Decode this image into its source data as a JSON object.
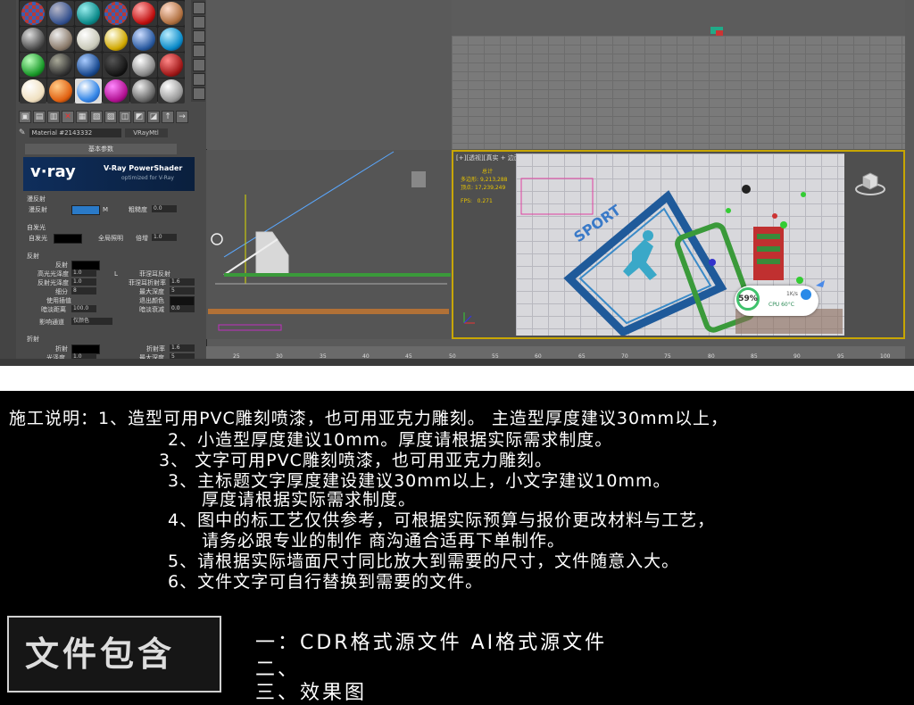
{
  "material_editor": {
    "material_name": "Material #2143332",
    "material_type": "VRayMtl",
    "rollout_title": "基本参数",
    "vray_logo": "v·ray",
    "vray_shader_title": "V-Ray PowerShader",
    "vray_shader_subtitle": "optimized for V-Ray",
    "sections": {
      "diffuse": "漫反射",
      "diffuse_label": "漫反射",
      "diffuse_map": "M",
      "roughness_label": "粗糙度",
      "roughness_value": "0.0",
      "selfillum": "自发光",
      "selfillum_label": "自发光",
      "gi_label": "全局照明",
      "multiplier_label": "倍增",
      "multiplier_value": "1.0",
      "reflect": "反射",
      "reflect_label": "反射",
      "hilight_gloss_label": "高光光泽度",
      "hilight_gloss_value": "1.0",
      "lock_label": "L",
      "fresnel_label": "菲涅耳反射",
      "refl_gloss_label": "反射光泽度",
      "refl_gloss_value": "1.0",
      "fresnel_ior_label": "菲涅耳折射率",
      "fresnel_ior_value": "1.6",
      "subdivs_label": "细分",
      "subdivs_value": "8",
      "max_depth_label": "最大深度",
      "max_depth_value": "5",
      "use_interp_label": "使用插值",
      "exit_color_label": "退出颜色",
      "dim_dist_label": "暗淡距离",
      "dim_dist_value": "100.0",
      "dim_falloff_label": "暗淡衰减",
      "dim_falloff_value": "0.0",
      "affect_channels_label": "影响通道",
      "affect_channels_value": "仅颜色",
      "refract": "折射",
      "refract_label": "折射",
      "ior_label": "折射率",
      "ior_value": "1.6",
      "gloss_label": "光泽度",
      "gloss_value": "1.0",
      "refr_max_depth_label": "最大深度",
      "refr_max_depth_value": "5"
    }
  },
  "viewport": {
    "label": "[+][透视][真实 + 边面]",
    "stats_total": "总计",
    "polys_label": "多边形:",
    "polys_value": "9,213,288",
    "verts_label": "顶点:",
    "verts_value": "17,239,249",
    "fps_label": "FPS:",
    "fps_value": "0.271",
    "sport_text": "SPORT"
  },
  "monitor": {
    "percent": "59%",
    "speed": "1K/s",
    "cpu": "CPU 60°C"
  },
  "ruler_ticks": [
    "25",
    "30",
    "35",
    "40",
    "45",
    "50",
    "55",
    "60",
    "65",
    "70",
    "75",
    "80",
    "85",
    "90",
    "95",
    "100"
  ],
  "notes": {
    "line1": "施工说明：1、造型可用PVC雕刻喷漆，也可用亚克力雕刻。 主造型厚度建议30mm以上，",
    "line2": "2、小造型厚度建议10mm。厚度请根据实际需求制度。",
    "line3": "3、 文字可用PVC雕刻喷漆，也可用亚克力雕刻。",
    "line4": "3、主标题文字厚度建设建议30mm以上，小文字建议10mm。",
    "line5": "厚度请根据实际需求制度。",
    "line6": "4、图中的标工艺仅供参考，可根据实际预算与报价更改材料与工艺，",
    "line7": "请务必跟专业的制作 商沟通合适再下单制作。",
    "line8": "5、请根据实际墙面尺寸同比放大到需要的尺寸，文件随意入大。",
    "line9": "6、文件文字可自行替换到需要的文件。"
  },
  "files": {
    "title": "文件包含",
    "item1": "一：CDR格式源文件  AI格式源文件",
    "item2": "二、",
    "item3": "三、效果图"
  },
  "colors": {
    "viewport_active_border": "#c8a600",
    "stats_text": "#e8c400"
  }
}
